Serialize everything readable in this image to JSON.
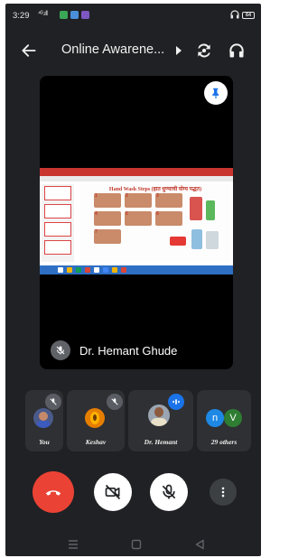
{
  "status_bar": {
    "time": "3:29",
    "signal_text": "⁴ᴳ.ıll",
    "battery": "64",
    "app_icons": [
      "#3aa757",
      "#4a90d9",
      "#7e57c2"
    ]
  },
  "app_bar": {
    "title": "Online Awarene...",
    "back_icon": "arrow-left-icon",
    "switch_camera_icon": "switch-camera-icon",
    "audio_icon": "headset-icon"
  },
  "main_video": {
    "speaker_name": "Dr. Hemant Ghude",
    "mic_muted": true,
    "pin_icon": "pin-icon",
    "slide_heading": "Hand Wash Steps (हात धुण्याची योग्य पद्धत)"
  },
  "participants": [
    {
      "name": "You",
      "muted": true
    },
    {
      "name": "Keshav",
      "muted": true
    },
    {
      "name": "Dr. Hemant",
      "speaking": true
    },
    {
      "name": "29 others",
      "avatars": [
        "n",
        "V"
      ]
    }
  ],
  "controls": {
    "end_call_icon": "end-call-icon",
    "camera_icon": "camera-off-icon",
    "mic_icon": "mic-off-icon",
    "more_icon": "more-vert-icon"
  },
  "colors": {
    "background": "#202124",
    "tile": "#2f3033",
    "end_call": "#ea4335",
    "speaking_badge": "#1a73e8",
    "avatar_n": "#1e88e5",
    "avatar_v": "#2e7d32"
  }
}
